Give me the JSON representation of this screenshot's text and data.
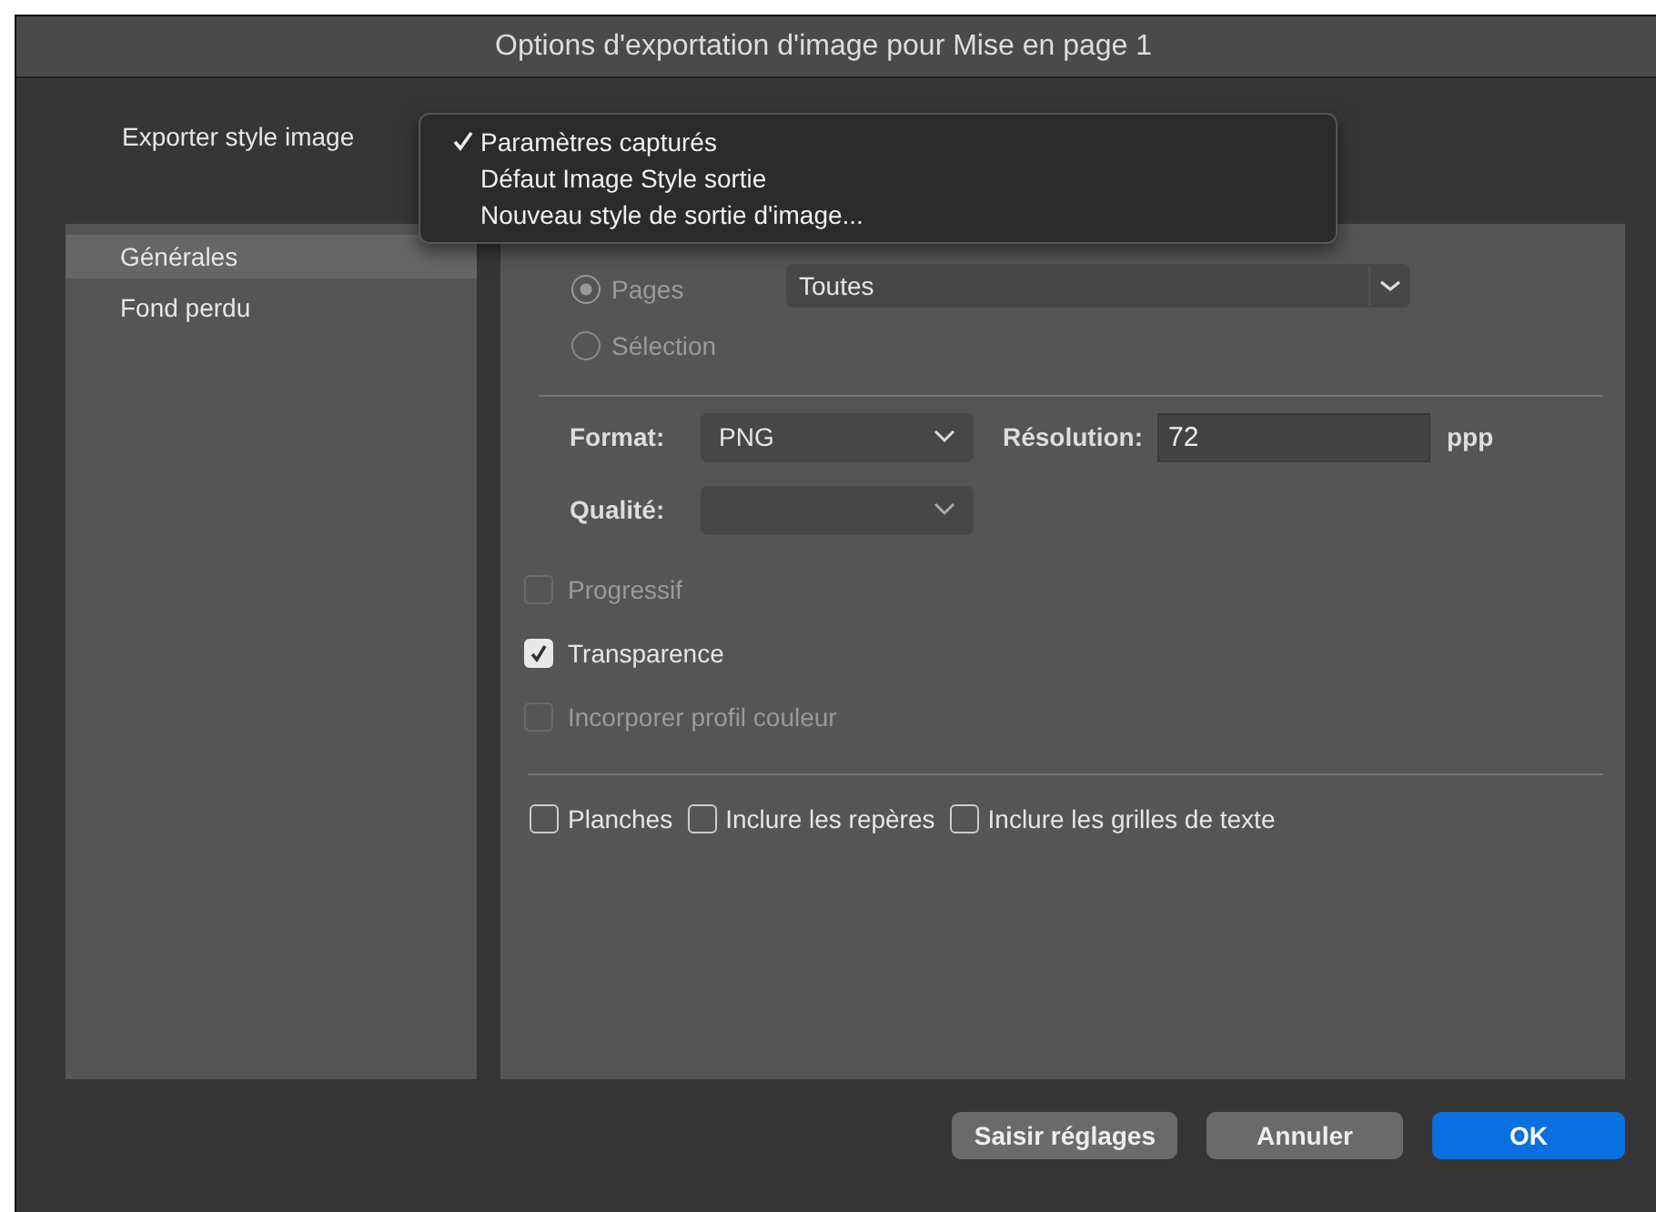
{
  "window": {
    "title": "Options d'exportation d'image pour Mise en page 1"
  },
  "export_style": {
    "label": "Exporter style image"
  },
  "style_menu": [
    {
      "label": "Paramètres capturés",
      "selected": true
    },
    {
      "label": "Défaut Image Style sortie",
      "selected": false
    },
    {
      "label": "Nouveau style de sortie d'image...",
      "selected": false
    }
  ],
  "sidebar": {
    "items": [
      {
        "label": "Générales",
        "selected": true
      },
      {
        "label": "Fond perdu",
        "selected": false
      }
    ]
  },
  "range": {
    "options": [
      {
        "label": "Pages",
        "selected": true
      },
      {
        "label": "Sélection",
        "selected": false
      }
    ],
    "value": "Toutes"
  },
  "format": {
    "label": "Format:",
    "value": "PNG"
  },
  "resolution": {
    "label": "Résolution:",
    "value": "72",
    "unit": "ppp"
  },
  "quality": {
    "label": "Qualité:"
  },
  "options": [
    {
      "label": "Progressif",
      "checked": false,
      "disabled": true
    },
    {
      "label": "Transparence",
      "checked": true,
      "disabled": false
    },
    {
      "label": "Incorporer profil couleur",
      "checked": false,
      "disabled": true
    }
  ],
  "inline_options": [
    {
      "label": "Planches",
      "checked": false
    },
    {
      "label": "Inclure les repères",
      "checked": false
    },
    {
      "label": "Inclure les grilles de texte",
      "checked": false
    }
  ],
  "buttons": [
    {
      "label": "Saisir réglages",
      "kind": "secondary"
    },
    {
      "label": "Annuler",
      "kind": "secondary"
    },
    {
      "label": "OK",
      "kind": "primary"
    }
  ]
}
